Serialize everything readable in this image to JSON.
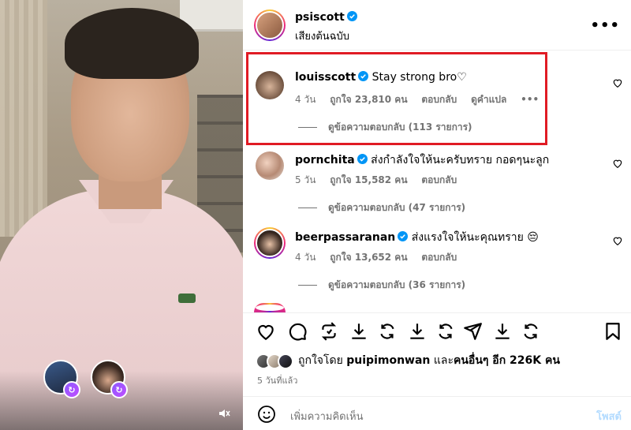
{
  "post": {
    "author": "psiscott",
    "audio": "เสียงต้นฉบับ",
    "more_label": "•••"
  },
  "comments": [
    {
      "user": "louisscott",
      "text": "Stay strong bro♡",
      "age": "4 วัน",
      "likes": "ถูกใจ 23,810 คน",
      "reply": "ตอบกลับ",
      "translate": "ดูคำแปล",
      "more": "•••",
      "view_replies": "ดูข้อความตอบกลับ (113 รายการ)"
    },
    {
      "user": "pornchita",
      "text": "ส่งกำลังใจให้นะครับทราย กอดๆนะลูก",
      "age": "5 วัน",
      "likes": "ถูกใจ 15,582 คน",
      "reply": "ตอบกลับ",
      "view_replies": "ดูข้อความตอบกลับ (47 รายการ)"
    },
    {
      "user": "beerpassaranan",
      "text": "ส่งแรงใจให้นะคุณทราย 😔",
      "age": "4 วัน",
      "likes": "ถูกใจ 13,652 คน",
      "reply": "ตอบกลับ",
      "view_replies": "ดูข้อความตอบกลับ (36 รายการ)"
    }
  ],
  "liked_by": {
    "prefix": "ถูกใจโดย ",
    "user": "puipimonwan",
    "middle": " และ",
    "others": "คนอื่นๆ อีก 226K คน"
  },
  "timestamp": "5 วันที่แล้ว",
  "comment_input": {
    "placeholder": "เพิ่มความคิดเห็น",
    "post_label": "โพสต์"
  },
  "action_icons": [
    "heart-icon",
    "comment-icon",
    "repost-icon",
    "download-icon",
    "refresh-icon",
    "download-icon",
    "refresh-icon",
    "share-icon",
    "download-icon",
    "refresh-icon",
    "save-icon"
  ],
  "colors": {
    "verified": "#0095f6",
    "highlight": "#e01b24",
    "post_button": "#b3dbff",
    "meta_text": "#737373"
  }
}
